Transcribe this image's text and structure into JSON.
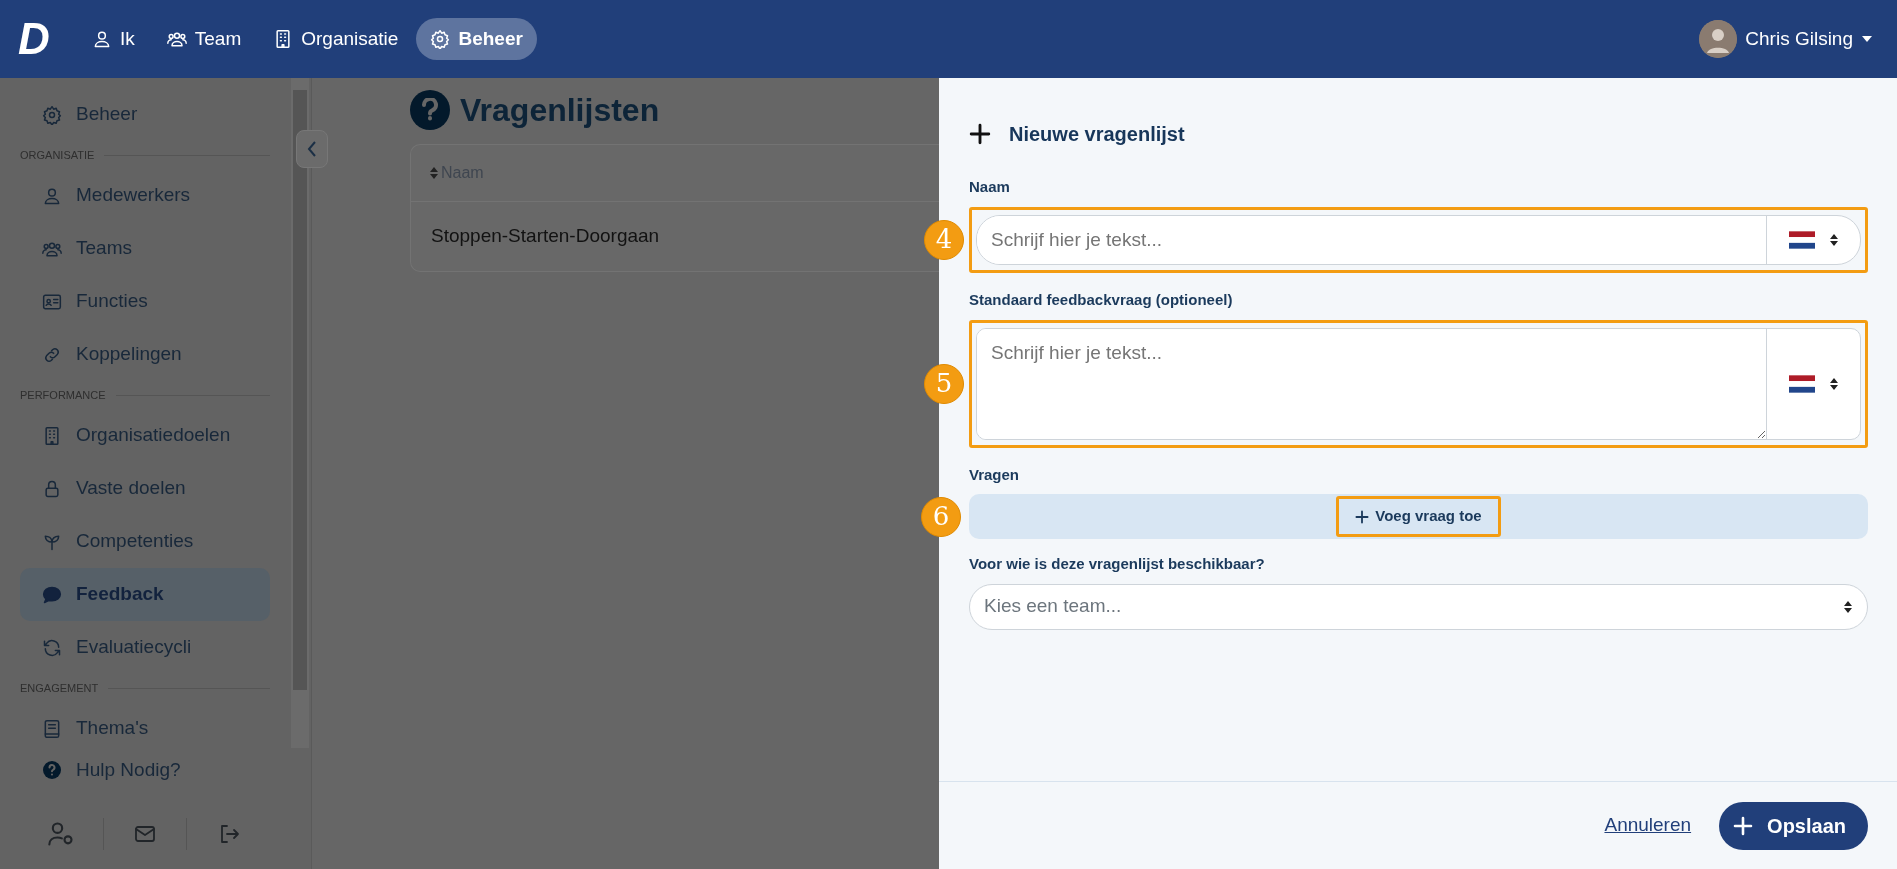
{
  "navbar": {
    "logo": "D",
    "items": [
      {
        "label": "Ik",
        "kind": "person",
        "selected": false
      },
      {
        "label": "Team",
        "kind": "people",
        "selected": false
      },
      {
        "label": "Organisatie",
        "kind": "building",
        "selected": false
      },
      {
        "label": "Beheer",
        "kind": "gear",
        "selected": true
      }
    ],
    "user": {
      "name": "Chris Gilsing"
    }
  },
  "sidebar": {
    "groups": [
      {
        "items": [
          {
            "label": "Beheer",
            "kind": "gear",
            "selected": false
          }
        ]
      },
      {
        "heading": "ORGANISATIE",
        "items": [
          {
            "label": "Medewerkers",
            "kind": "person",
            "selected": false
          },
          {
            "label": "Teams",
            "kind": "people",
            "selected": false
          },
          {
            "label": "Functies",
            "kind": "card",
            "selected": false
          },
          {
            "label": "Koppelingen",
            "kind": "link",
            "selected": false
          }
        ]
      },
      {
        "heading": "PERFORMANCE",
        "items": [
          {
            "label": "Organisatiedoelen",
            "kind": "building",
            "selected": false
          },
          {
            "label": "Vaste doelen",
            "kind": "lock",
            "selected": false
          },
          {
            "label": "Competenties",
            "kind": "sprout",
            "selected": false
          },
          {
            "label": "Feedback",
            "kind": "chat",
            "selected": true
          },
          {
            "label": "Evaluatiecycli",
            "kind": "cycle",
            "selected": false
          }
        ]
      },
      {
        "heading": "ENGAGEMENT",
        "items": [
          {
            "label": "Thema's",
            "kind": "book",
            "selected": false
          }
        ]
      }
    ],
    "help": "Hulp Nodig?"
  },
  "page": {
    "title": "Vragenlijsten",
    "table": {
      "columns": [
        "Naam"
      ],
      "rows": [
        "Stoppen-Starten-Doorgaan"
      ]
    }
  },
  "panel": {
    "title": "Nieuwe vragenlijst",
    "fields": [
      {
        "kind": "text",
        "label": "Naam",
        "placeholder": "Schrijf hier je tekst...",
        "marker": "4"
      },
      {
        "kind": "textarea",
        "label": "Standaard feedbackvraag (optioneel)",
        "placeholder": "Schrijf hier je tekst...",
        "marker": "5"
      },
      {
        "kind": "questions",
        "label": "Vragen",
        "button": "Voeg vraag toe",
        "marker": "6"
      },
      {
        "kind": "select",
        "label": "Voor wie is deze vragenlijst beschikbaar?",
        "placeholder": "Kies een team..."
      }
    ],
    "cancel": "Annuleren",
    "save": "Opslaan"
  }
}
